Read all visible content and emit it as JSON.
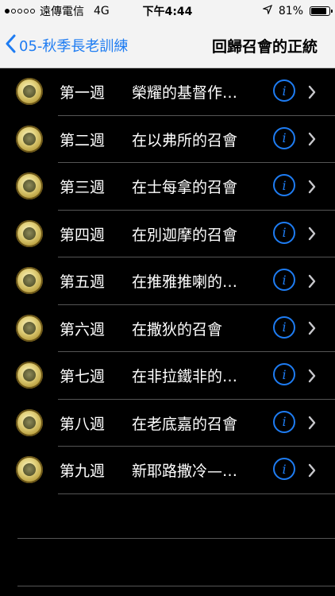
{
  "status": {
    "carrier": "遠傳電信",
    "network": "4G",
    "time": "下午4:44",
    "battery": "81%",
    "icons": [
      "signal-dots",
      "location-arrow-icon",
      "battery-icon"
    ]
  },
  "nav": {
    "back_label": "05-秋季長老訓練",
    "title": "回歸召會的正統"
  },
  "colors": {
    "accent": "#1e7cf2",
    "background": "#000000",
    "bar": "#f3f3f3"
  },
  "items": [
    {
      "week": "第一週",
      "title": "榮耀的基督作…"
    },
    {
      "week": "第二週",
      "title": "在以弗所的召會"
    },
    {
      "week": "第三週",
      "title": "在士每拿的召會"
    },
    {
      "week": "第四週",
      "title": "在別迦摩的召會"
    },
    {
      "week": "第五週",
      "title": "在推雅推喇的…"
    },
    {
      "week": "第六週",
      "title": "在撒狄的召會"
    },
    {
      "week": "第七週",
      "title": "在非拉鐵非的…"
    },
    {
      "week": "第八週",
      "title": "在老底嘉的召會"
    },
    {
      "week": "第九週",
      "title": "新耶路撒冷—…"
    }
  ]
}
